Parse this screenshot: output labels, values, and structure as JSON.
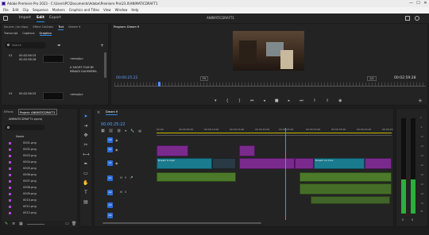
{
  "window": {
    "title": "Adobe Premiere Pro 2023 - C:\\Users\\PC\\Documents\\Adobe\\Premiere Pro\\23.0\\ANIMATICDRAFT1",
    "minimize": "—",
    "maximize": "☐",
    "close": "✕"
  },
  "menu": [
    "File",
    "Edit",
    "Clip",
    "Sequence",
    "Markers",
    "Graphics and Titles",
    "View",
    "Window",
    "Help"
  ],
  "workspace": {
    "tabs": [
      "Import",
      "Edit",
      "Export"
    ],
    "active": "Edit",
    "project_title": "ANIMATICDRAFT1"
  },
  "source_panel": {
    "tabs": [
      "Source: (no clips)",
      "Effect Controls",
      "Graphics",
      "Text",
      "Dream 9"
    ],
    "active_tab": "Graphics",
    "subtabs": [
      "Transcript",
      "Captions",
      "Graphics"
    ],
    "search_placeholder": "Search",
    "items": [
      {
        "track": "V1",
        "start": "00:02:56:15",
        "end": "00:02:58:16",
        "text": "<empty>"
      },
      {
        "track": "V1",
        "start": "00:02:56:15",
        "end": "00:02:58:16",
        "text": "A SHORT FILM BY MINADI GAUMEERA"
      },
      {
        "track": "V1",
        "start": "00:02:56:15",
        "end": "",
        "text": "<empty>"
      }
    ]
  },
  "program_monitor": {
    "title": "Program: Dream 9",
    "timecode": "00:00:25:22",
    "fit": "Fit",
    "quality": "1/2",
    "duration": "00:02:59:28"
  },
  "project_panel": {
    "tabs": [
      "Effects",
      "Project: ANIMATICDRAFT1"
    ],
    "active_tab": "Project: ANIMATICDRAFT1",
    "file": "ANIMATICDRAFT1.prproj",
    "column": "Name",
    "files": [
      "0001.png",
      "0002.png",
      "0003.png",
      "0004.png",
      "0005.png",
      "0006.png",
      "0007.png",
      "0008.png",
      "0009.png",
      "0010.png",
      "0011.png",
      "0012.png",
      "0013.png",
      "0014.png"
    ]
  },
  "timeline": {
    "tab": "Dream 9",
    "timecode": "00:00:25:22",
    "ruler": [
      "00:00",
      "00:00:05:00",
      "00:00:10:00",
      "00:00:15:00",
      "00:00:20:00",
      "00:00:25:00",
      "00:00:30:00",
      "00:00:35:00",
      "00:00:40:00",
      "00:00:45"
    ],
    "video_tracks": [
      "V3",
      "V2",
      "V1"
    ],
    "audio_tracks": [
      "A1",
      "A2",
      "A3",
      "A4"
    ],
    "clips": {
      "v1a": "Dream 9.mp4",
      "v1b": "Dream 11.mov"
    }
  },
  "meters": {
    "labels": [
      "0",
      "-6",
      "-12",
      "-18",
      "-24",
      "-30",
      "-36",
      "-42",
      "-48",
      "-54",
      "dB"
    ],
    "left_level": 0.36,
    "right_level": 0.36,
    "solo": "S",
    "mute": "M"
  },
  "colors": {
    "accent": "#2d8ceb",
    "playhead": "#4a90ff",
    "video_clip": "#7a2a8c",
    "video_clip_alt": "#1a7a8e",
    "audio_clip": "#4c7a2a",
    "meter_green": "#2fae3e"
  }
}
